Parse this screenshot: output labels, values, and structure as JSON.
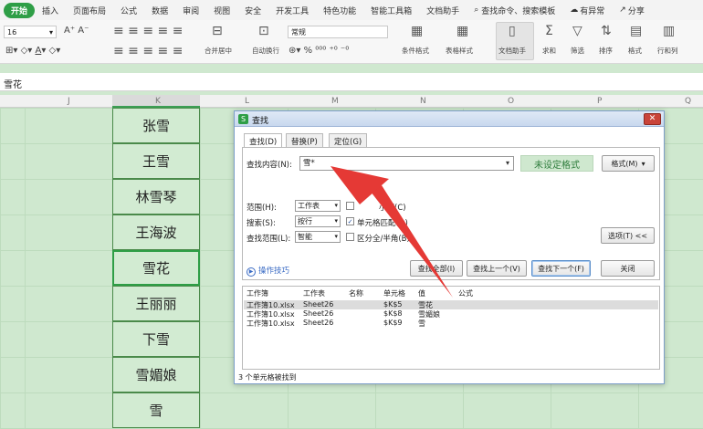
{
  "tabs": [
    "开始",
    "插入",
    "页面布局",
    "公式",
    "数据",
    "审阅",
    "视图",
    "安全",
    "开发工具",
    "特色功能",
    "智能工具箱",
    "文档助手",
    "查找命令、搜索模板",
    "有异常",
    "分享"
  ],
  "ribbon": {
    "font_size": "16",
    "number_format": "常规",
    "labels": [
      "合并居中",
      "自动换行",
      "条件格式",
      "表格样式",
      "文档助手",
      "求和",
      "筛选",
      "排序",
      "格式",
      "行和列"
    ]
  },
  "formula_bar": {
    "value": "雪花"
  },
  "columns": [
    "J",
    "K",
    "L",
    "M",
    "N",
    "O",
    "P",
    "Q"
  ],
  "cells": [
    "张雪",
    "王雪",
    "林雪琴",
    "王海波",
    "雪花",
    "王丽丽",
    "下雪",
    "雪媚娘",
    "雪"
  ],
  "dialog": {
    "title": "查找",
    "tabs": [
      "查找(D)",
      "替换(P)",
      "定位(G)"
    ],
    "find_label": "查找内容(N):",
    "find_value": "雪*",
    "no_format": "未设定格式",
    "format_btn": "格式(M)",
    "scope_label": "范围(H):",
    "scope_value": "工作表",
    "search_label": "搜索(S):",
    "search_value": "按行",
    "lookin_label": "查找范围(L):",
    "lookin_value": "智能",
    "opt_case": "小写(C)",
    "opt_cell": "单元格匹配(O)",
    "opt_width": "区分全/半角(B)",
    "options_btn": "选项(T) <<",
    "tips": "操作技巧",
    "find_all": "查找全部(I)",
    "find_prev": "查找上一个(V)",
    "find_next": "查找下一个(F)",
    "close": "关闭",
    "result_headers": [
      "工作簿",
      "工作表",
      "名称",
      "单元格",
      "值",
      "公式"
    ],
    "results": [
      {
        "book": "工作簿10.xlsx",
        "sheet": "Sheet26",
        "cell": "$K$5",
        "value": "雪花"
      },
      {
        "book": "工作簿10.xlsx",
        "sheet": "Sheet26",
        "cell": "$K$8",
        "value": "雪媚娘"
      },
      {
        "book": "工作簿10.xlsx",
        "sheet": "Sheet26",
        "cell": "$K$9",
        "value": "雪"
      }
    ],
    "status": "3 个单元格被找到"
  },
  "colors": {
    "accent": "#2e9e46",
    "annotation": "#e53935"
  }
}
